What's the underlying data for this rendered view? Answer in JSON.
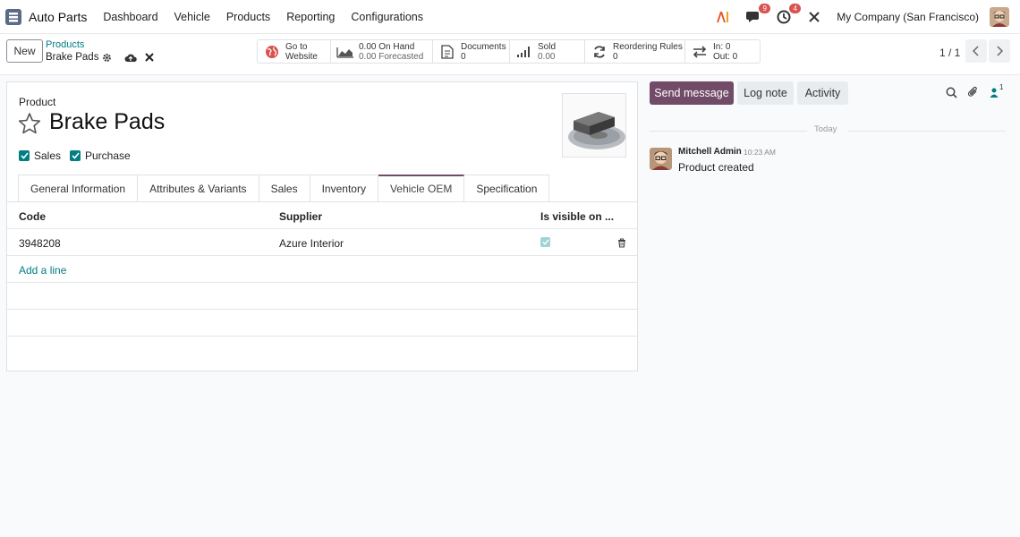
{
  "app": {
    "name": "Auto Parts",
    "icon": "auto-parts-app-icon"
  },
  "menu": [
    "Dashboard",
    "Vehicle",
    "Products",
    "Reporting",
    "Configurations"
  ],
  "systray": {
    "ai_icon": "ai-icon",
    "messages_badge": "9",
    "activities_badge": "4",
    "company": "My Company (San Francisco)"
  },
  "control_panel": {
    "new_label": "New",
    "breadcrumb_parent": "Products",
    "breadcrumb_current": "Brake Pads",
    "pager": "1 / 1"
  },
  "smart_buttons": {
    "website": {
      "line1": "Go to",
      "line2": "Website"
    },
    "onhand": {
      "line1": "0.00 On Hand",
      "line2": "0.00 Forecasted"
    },
    "documents": {
      "line1": "Documents",
      "line2": "0"
    },
    "sold": {
      "line1": "Sold",
      "line2": "0.00"
    },
    "reordering": {
      "line1": "Reordering Rules",
      "line2": "0"
    },
    "inout": {
      "line1": "In: 0",
      "line2": "Out: 0"
    }
  },
  "form": {
    "label": "Product",
    "name": "Brake Pads",
    "checkbox_sales": "Sales",
    "checkbox_purchase": "Purchase",
    "tabs": [
      "General Information",
      "Attributes & Variants",
      "Sales",
      "Inventory",
      "Vehicle OEM",
      "Specification"
    ],
    "active_tab": "Vehicle OEM",
    "table": {
      "headers": {
        "code": "Code",
        "supplier": "Supplier",
        "visible": "Is visible on ..."
      },
      "rows": [
        {
          "code": "3948208",
          "supplier": "Azure Interior"
        }
      ],
      "add_line": "Add a line"
    }
  },
  "chatter": {
    "send_message": "Send message",
    "log_note": "Log note",
    "activity": "Activity",
    "followers_count": "1",
    "date_separator": "Today",
    "message": {
      "author": "Mitchell Admin",
      "time": "10:23 AM",
      "body": "Product created"
    }
  },
  "colors": {
    "brand": "#714b67",
    "accent": "#017e84",
    "badge": "#d9534f"
  }
}
